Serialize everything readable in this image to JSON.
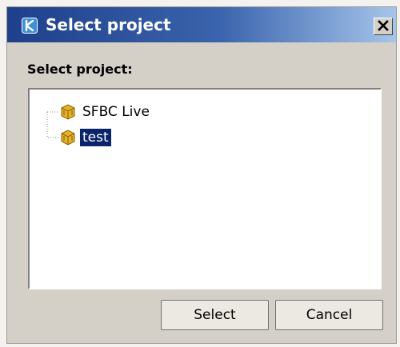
{
  "window": {
    "title": "Select project",
    "close_symbol": "×"
  },
  "dialog": {
    "prompt": "Select project:"
  },
  "projects": [
    {
      "label": "SFBC Live",
      "selected": false,
      "icon": "project-cube-icon"
    },
    {
      "label": "test",
      "selected": true,
      "icon": "project-cube-icon"
    }
  ],
  "buttons": {
    "select_label": "Select",
    "cancel_label": "Cancel"
  },
  "colors": {
    "title_gradient_start": "#1f3f8a",
    "title_gradient_end": "#a6c5ea",
    "selection_bg": "#0a246a",
    "icon_gold": "#d7a41a"
  }
}
